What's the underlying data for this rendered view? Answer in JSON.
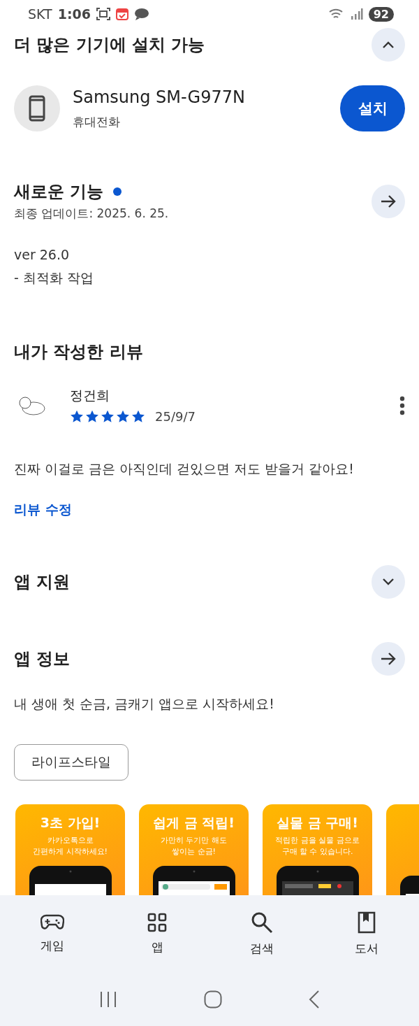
{
  "status_bar": {
    "carrier": "SKT",
    "time": "1:06",
    "battery": "92"
  },
  "install_section": {
    "title": "더 많은 기기에 설치 가능",
    "device": {
      "name": "Samsung SM-G977N",
      "type": "휴대전화"
    },
    "install_button": "설치"
  },
  "whats_new": {
    "title": "새로운 기능",
    "updated": "최종 업데이트: 2025. 6. 25.",
    "version": "ver 26.0",
    "notes": "- 최적화 작업"
  },
  "my_review": {
    "title": "내가 작성한 리뷰",
    "author": "정건희",
    "stars": 5,
    "date": "25/9/7",
    "text": "진짜 이걸로 금은 아직인데 걷있으면 저도 받을거 같아요!",
    "edit_link": "리뷰 수정"
  },
  "app_support": {
    "title": "앱 지원",
    "expanded": false
  },
  "app_info": {
    "title": "앱 정보",
    "description": "내 생애 첫 순금, 금캐기 앱으로 시작하세요!",
    "tag": "라이프스타일"
  },
  "screenshots": [
    {
      "title": "3초 가입!",
      "subtitle": "카카오톡으로\n간편하게 시작하세요!"
    },
    {
      "title": "쉽게 금 적립!",
      "subtitle": "가만히 두기만 해도\n쌓이는 순금!"
    },
    {
      "title": "실물 금 구매!",
      "subtitle": "적립한 금을 실물 금으로\n구매 할 수 있습니다."
    },
    {
      "kind": "picture"
    }
  ],
  "bottom_nav": [
    {
      "label": "게임",
      "kind": "games"
    },
    {
      "label": "앱",
      "kind": "apps"
    },
    {
      "label": "검색",
      "kind": "search"
    },
    {
      "label": "도서",
      "kind": "books"
    }
  ]
}
